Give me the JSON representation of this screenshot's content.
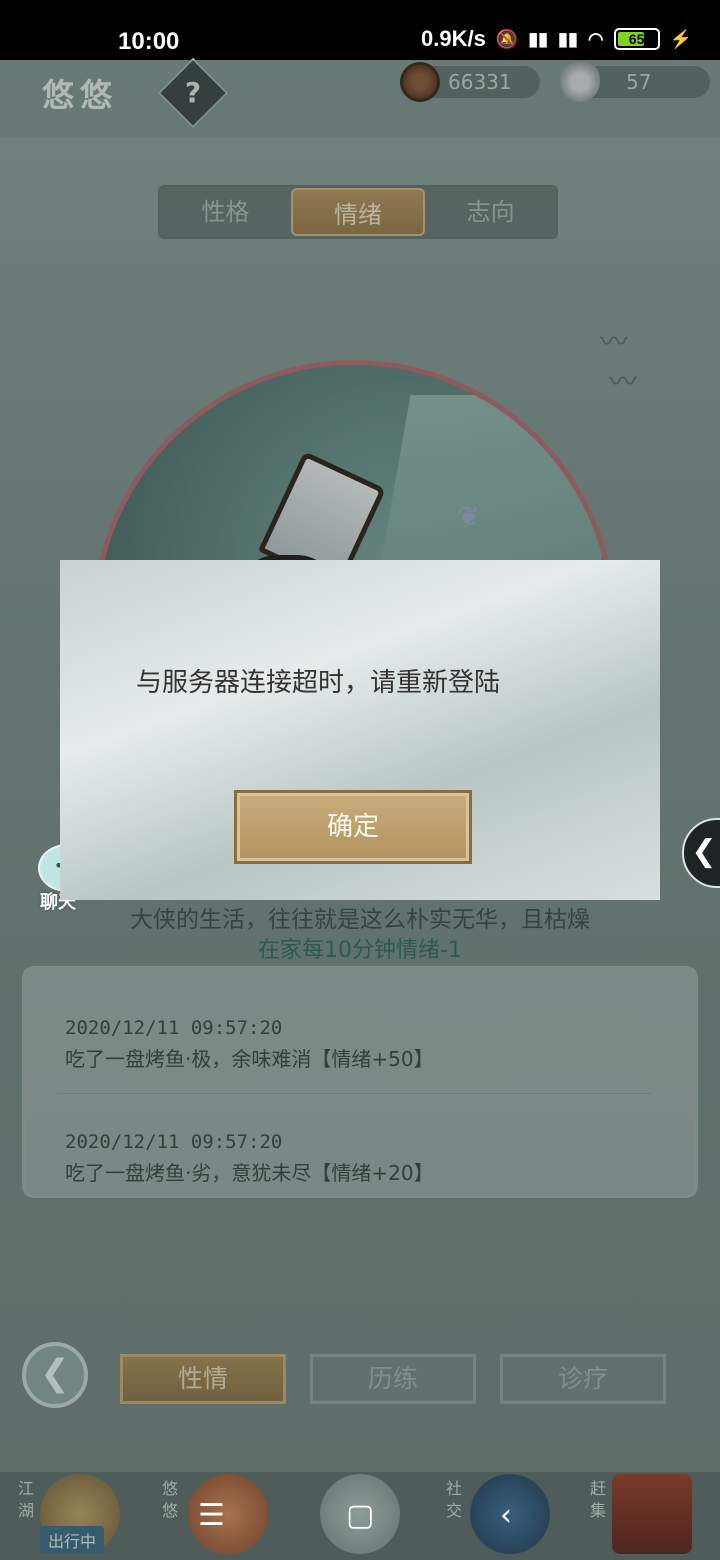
{
  "status_bar": {
    "time": "10:00",
    "network_speed": "0.9K/s",
    "battery_level": "65"
  },
  "header": {
    "title": "悠悠",
    "help_label": "?",
    "coins": "66331",
    "ingots": "57"
  },
  "tabs": [
    {
      "label": "性格",
      "active": false
    },
    {
      "label": "情绪",
      "active": true
    },
    {
      "label": "志向",
      "active": false
    }
  ],
  "mood": {
    "description": "大侠的生活，往往就是这么朴实无华，且枯燥",
    "effect": "在家每10分钟情绪-1"
  },
  "log": [
    {
      "time": "2020/12/11 09:57:20",
      "message": "吃了一盘烤鱼·极，余味难消【情绪+50】"
    },
    {
      "time": "2020/12/11 09:57:20",
      "message": "吃了一盘烤鱼·劣，意犹未尽【情绪+20】"
    }
  ],
  "bottom_tabs": [
    {
      "label": "性情",
      "active": true
    },
    {
      "label": "历练",
      "active": false
    },
    {
      "label": "诊疗",
      "active": false
    }
  ],
  "bottom_nav": {
    "jianghu": "江湖",
    "youyou": "悠悠",
    "social": "社交",
    "market": "赶集",
    "on_trip": "出行中"
  },
  "chat": {
    "label": "聊天"
  },
  "dialog": {
    "message": "与服务器连接超时，请重新登陆",
    "confirm_label": "确定"
  },
  "colors": {
    "active_tab": "#a8864f",
    "dialog_button": "#bfa270",
    "portrait_ring": "#b56a71"
  }
}
